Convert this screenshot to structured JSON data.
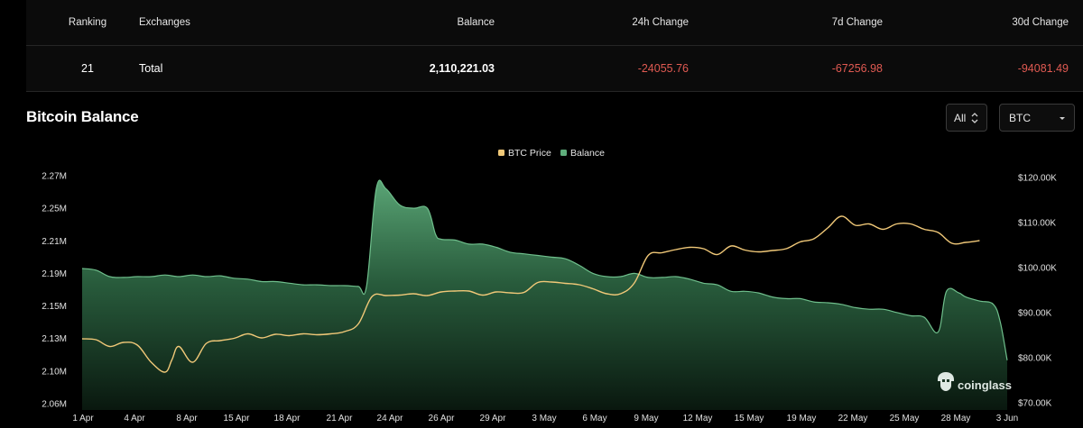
{
  "table": {
    "headers": {
      "ranking": "Ranking",
      "exchanges": "Exchanges",
      "balance": "Balance",
      "change_24h": "24h Change",
      "change_7d": "7d Change",
      "change_30d": "30d Change"
    },
    "row": {
      "ranking": "21",
      "exchange": "Total",
      "balance": "2,110,221.03",
      "change_24h": "-24055.76",
      "change_7d": "-67256.98",
      "change_30d": "-94081.49"
    },
    "negative_color": "#e05a52"
  },
  "section": {
    "title": "Bitcoin Balance",
    "range_select": "All",
    "unit_select": "BTC"
  },
  "watermark": "coinglass",
  "colors": {
    "balance": "#5fae7c",
    "btc_price": "#f0c878"
  },
  "chart_data": {
    "type": "area",
    "title": "",
    "legend": [
      "BTC Price",
      "Balance"
    ],
    "legend_position": "top-center",
    "grid": false,
    "x_ticks": [
      "1 Apr",
      "4 Apr",
      "8 Apr",
      "15 Apr",
      "18 Apr",
      "21 Apr",
      "24 Apr",
      "26 Apr",
      "29 Apr",
      "3 May",
      "6 May",
      "9 May",
      "12 May",
      "15 May",
      "19 May",
      "22 May",
      "25 May",
      "28 May",
      "3 Jun"
    ],
    "y_left_ticks": [
      "2.27M",
      "2.25M",
      "2.21M",
      "2.19M",
      "2.15M",
      "2.13M",
      "2.10M",
      "2.06M"
    ],
    "y_right_ticks": [
      "$120.00K",
      "$110.00K",
      "$100.00K",
      "$90.00K",
      "$80.00K",
      "$70.00K"
    ],
    "y_right_range": [
      70000,
      120000
    ],
    "series": [
      {
        "name": "Balance",
        "axis": "left",
        "style": "area",
        "points": [
          [
            0,
            2.193
          ],
          [
            1,
            2.192
          ],
          [
            2,
            2.186
          ],
          [
            3,
            2.185
          ],
          [
            4,
            2.186
          ],
          [
            5,
            2.186
          ],
          [
            6,
            2.188
          ],
          [
            7,
            2.186
          ],
          [
            8,
            2.188
          ],
          [
            9,
            2.186
          ],
          [
            10,
            2.187
          ],
          [
            11,
            2.184
          ],
          [
            12,
            2.183
          ],
          [
            13,
            2.18
          ],
          [
            14,
            2.18
          ],
          [
            15,
            2.178
          ],
          [
            16,
            2.176
          ],
          [
            17,
            2.176
          ],
          [
            18,
            2.175
          ],
          [
            19,
            2.175
          ],
          [
            20,
            2.174
          ],
          [
            20.6,
            2.174
          ],
          [
            21.3,
            2.262
          ],
          [
            22,
            2.262
          ],
          [
            23,
            2.252
          ],
          [
            24,
            2.25
          ],
          [
            25,
            2.25
          ],
          [
            25.6,
            2.218
          ],
          [
            26,
            2.212
          ],
          [
            27,
            2.211
          ],
          [
            28,
            2.208
          ],
          [
            29,
            2.208
          ],
          [
            30,
            2.206
          ],
          [
            31,
            2.203
          ],
          [
            32,
            2.202
          ],
          [
            33,
            2.201
          ],
          [
            34,
            2.2
          ],
          [
            35,
            2.199
          ],
          [
            36,
            2.195
          ],
          [
            37,
            2.19
          ],
          [
            38,
            2.186
          ],
          [
            39,
            2.186
          ],
          [
            40,
            2.19
          ],
          [
            41,
            2.185
          ],
          [
            42,
            2.185
          ],
          [
            43,
            2.186
          ],
          [
            44,
            2.183
          ],
          [
            45,
            2.178
          ],
          [
            46,
            2.176
          ],
          [
            47,
            2.168
          ],
          [
            48,
            2.168
          ],
          [
            49,
            2.166
          ],
          [
            50,
            2.161
          ],
          [
            51,
            2.159
          ],
          [
            52,
            2.159
          ],
          [
            53,
            2.155
          ],
          [
            54,
            2.154
          ],
          [
            55,
            2.152
          ],
          [
            56,
            2.149
          ],
          [
            57,
            2.148
          ],
          [
            58,
            2.148
          ],
          [
            59,
            2.146
          ],
          [
            60,
            2.144
          ],
          [
            61,
            2.143
          ],
          [
            62,
            2.134
          ],
          [
            62.6,
            2.168
          ],
          [
            63.5,
            2.166
          ],
          [
            64,
            2.161
          ],
          [
            65,
            2.156
          ],
          [
            66,
            2.152
          ],
          [
            66.5,
            2.14
          ],
          [
            67,
            2.11
          ]
        ]
      },
      {
        "name": "BTC Price",
        "axis": "right",
        "style": "line",
        "points": [
          [
            0,
            84200
          ],
          [
            1,
            84000
          ],
          [
            2,
            82500
          ],
          [
            3,
            83400
          ],
          [
            4,
            82800
          ],
          [
            5,
            79000
          ],
          [
            6,
            76800
          ],
          [
            6.5,
            79500
          ],
          [
            7,
            82500
          ],
          [
            8,
            79000
          ],
          [
            9,
            83200
          ],
          [
            10,
            83800
          ],
          [
            11,
            84300
          ],
          [
            12,
            85300
          ],
          [
            13,
            84400
          ],
          [
            14,
            85200
          ],
          [
            15,
            84900
          ],
          [
            16,
            85300
          ],
          [
            17,
            85100
          ],
          [
            18,
            85300
          ],
          [
            19,
            85800
          ],
          [
            20,
            87500
          ],
          [
            21,
            93600
          ],
          [
            22,
            93800
          ],
          [
            23,
            93900
          ],
          [
            24,
            94200
          ],
          [
            25,
            93800
          ],
          [
            26,
            94600
          ],
          [
            27,
            94800
          ],
          [
            28,
            94800
          ],
          [
            29,
            93900
          ],
          [
            30,
            94600
          ],
          [
            31,
            94400
          ],
          [
            32,
            94500
          ],
          [
            33,
            96700
          ],
          [
            34,
            96800
          ],
          [
            35,
            96500
          ],
          [
            36,
            96200
          ],
          [
            37,
            95300
          ],
          [
            38,
            94200
          ],
          [
            39,
            94200
          ],
          [
            40,
            96600
          ],
          [
            41,
            102700
          ],
          [
            42,
            103300
          ],
          [
            43,
            104000
          ],
          [
            44,
            104500
          ],
          [
            45,
            104200
          ],
          [
            46,
            102900
          ],
          [
            47,
            104800
          ],
          [
            48,
            103900
          ],
          [
            49,
            103500
          ],
          [
            50,
            103800
          ],
          [
            51,
            104200
          ],
          [
            52,
            105700
          ],
          [
            53,
            106400
          ],
          [
            54,
            108800
          ],
          [
            55,
            111400
          ],
          [
            56,
            109400
          ],
          [
            57,
            109700
          ],
          [
            58,
            108500
          ],
          [
            59,
            109700
          ],
          [
            60,
            109700
          ],
          [
            61,
            108500
          ],
          [
            62,
            107800
          ],
          [
            63,
            105400
          ],
          [
            64,
            105600
          ],
          [
            65,
            106000
          ]
        ]
      }
    ]
  }
}
